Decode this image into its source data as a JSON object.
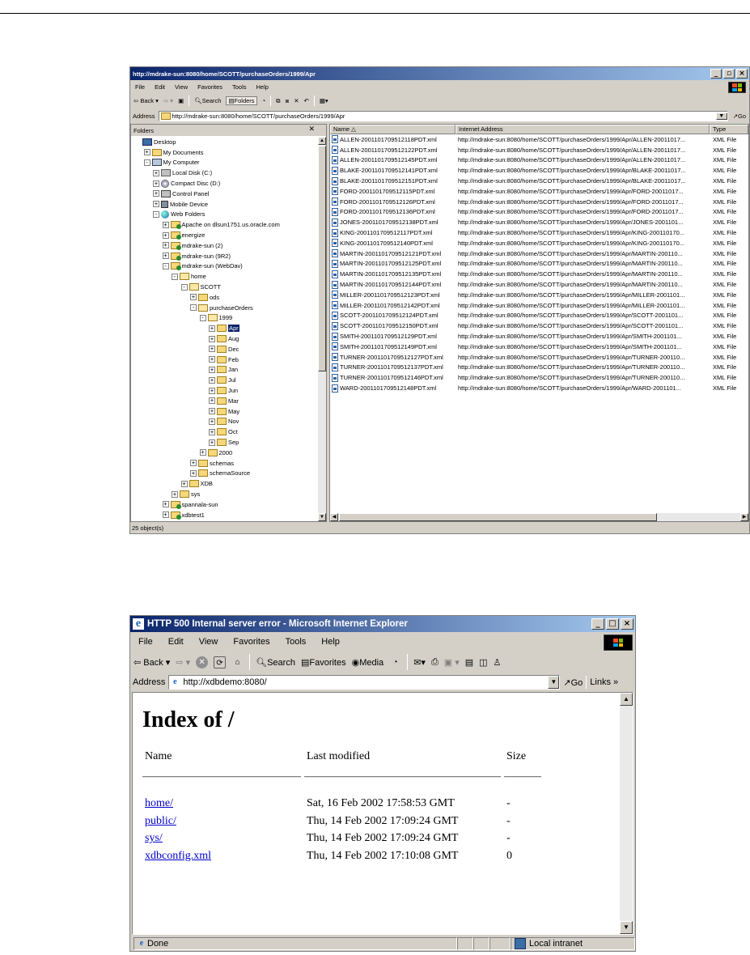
{
  "explorer": {
    "title": "http://mdrake-sun:8080/home/SCOTT/purchaseOrders/1999/Apr",
    "menu": [
      "File",
      "Edit",
      "View",
      "Favorites",
      "Tools",
      "Help"
    ],
    "toolbar": {
      "back": "Back",
      "search": "Search",
      "folders": "Folders"
    },
    "address_label": "Address",
    "address_value": "http://mdrake-sun:8080/home/SCOTT/purchaseOrders/1999/Apr",
    "go_label": "Go",
    "folders_title": "Folders",
    "tree": [
      {
        "label": "Desktop",
        "indent": 0,
        "expander": "",
        "icon": "desk"
      },
      {
        "label": "My Documents",
        "indent": 1,
        "expander": "+",
        "icon": "folder"
      },
      {
        "label": "My Computer",
        "indent": 1,
        "expander": "-",
        "icon": "pc"
      },
      {
        "label": "Local Disk (C:)",
        "indent": 2,
        "expander": "+",
        "icon": "drive"
      },
      {
        "label": "Compact Disc (D:)",
        "indent": 2,
        "expander": "+",
        "icon": "cd"
      },
      {
        "label": "Control Panel",
        "indent": 2,
        "expander": "+",
        "icon": "panel"
      },
      {
        "label": "Mobile Device",
        "indent": 2,
        "expander": "+",
        "icon": "device"
      },
      {
        "label": "Web Folders",
        "indent": 2,
        "expander": "-",
        "icon": "globe"
      },
      {
        "label": "Apache on dlsun1751.us.oracle.com",
        "indent": 3,
        "expander": "+",
        "icon": "webfolder"
      },
      {
        "label": "energize",
        "indent": 3,
        "expander": "+",
        "icon": "webfolder"
      },
      {
        "label": "mdrake-sun (2)",
        "indent": 3,
        "expander": "+",
        "icon": "webfolder"
      },
      {
        "label": "mdrake-sun (9R2)",
        "indent": 3,
        "expander": "+",
        "icon": "webfolder"
      },
      {
        "label": "mdrake-sun (WebDav)",
        "indent": 3,
        "expander": "-",
        "icon": "webfolder"
      },
      {
        "label": "home",
        "indent": 4,
        "expander": "-",
        "icon": "folder"
      },
      {
        "label": "SCOTT",
        "indent": 5,
        "expander": "-",
        "icon": "folder"
      },
      {
        "label": "ods",
        "indent": 6,
        "expander": "+",
        "icon": "folder"
      },
      {
        "label": "purchaseOrders",
        "indent": 6,
        "expander": "-",
        "icon": "folder"
      },
      {
        "label": "1999",
        "indent": 7,
        "expander": "-",
        "icon": "folder"
      },
      {
        "label": "Apr",
        "indent": 8,
        "expander": "+",
        "icon": "folder",
        "selected": true
      },
      {
        "label": "Aug",
        "indent": 8,
        "expander": "+",
        "icon": "folder"
      },
      {
        "label": "Dec",
        "indent": 8,
        "expander": "+",
        "icon": "folder"
      },
      {
        "label": "Feb",
        "indent": 8,
        "expander": "+",
        "icon": "folder"
      },
      {
        "label": "Jan",
        "indent": 8,
        "expander": "+",
        "icon": "folder"
      },
      {
        "label": "Jul",
        "indent": 8,
        "expander": "+",
        "icon": "folder"
      },
      {
        "label": "Jun",
        "indent": 8,
        "expander": "+",
        "icon": "folder"
      },
      {
        "label": "Mar",
        "indent": 8,
        "expander": "+",
        "icon": "folder"
      },
      {
        "label": "May",
        "indent": 8,
        "expander": "+",
        "icon": "folder"
      },
      {
        "label": "Nov",
        "indent": 8,
        "expander": "+",
        "icon": "folder"
      },
      {
        "label": "Oct",
        "indent": 8,
        "expander": "+",
        "icon": "folder"
      },
      {
        "label": "Sep",
        "indent": 8,
        "expander": "+",
        "icon": "folder"
      },
      {
        "label": "2000",
        "indent": 7,
        "expander": "+",
        "icon": "folder"
      },
      {
        "label": "schemas",
        "indent": 6,
        "expander": "+",
        "icon": "folder"
      },
      {
        "label": "schemaSource",
        "indent": 6,
        "expander": "+",
        "icon": "folder"
      },
      {
        "label": "XDB",
        "indent": 5,
        "expander": "+",
        "icon": "folder"
      },
      {
        "label": "sys",
        "indent": 4,
        "expander": "+",
        "icon": "folder"
      },
      {
        "label": "spannala-sun",
        "indent": 3,
        "expander": "+",
        "icon": "webfolder"
      },
      {
        "label": "xdbtest1",
        "indent": 3,
        "expander": "+",
        "icon": "webfolder"
      }
    ],
    "columns": [
      "Name",
      "Internet Address",
      "Type"
    ],
    "files": [
      {
        "name": "ALLEN-2001101709512118PDT.xml",
        "address": "http://mdrake-sun:8080/home/SCOTT/purchaseOrders/1999/Apr/ALLEN-20011017...",
        "type": "XML File"
      },
      {
        "name": "ALLEN-2001101709512122PDT.xml",
        "address": "http://mdrake-sun:8080/home/SCOTT/purchaseOrders/1999/Apr/ALLEN-20011017...",
        "type": "XML File"
      },
      {
        "name": "ALLEN-2001101709512145PDT.xml",
        "address": "http://mdrake-sun:8080/home/SCOTT/purchaseOrders/1999/Apr/ALLEN-20011017...",
        "type": "XML File"
      },
      {
        "name": "BLAKE-2001101709512141PDT.xml",
        "address": "http://mdrake-sun:8080/home/SCOTT/purchaseOrders/1999/Apr/BLAKE-20011017...",
        "type": "XML File"
      },
      {
        "name": "BLAKE-2001101709512151PDT.xml",
        "address": "http://mdrake-sun:8080/home/SCOTT/purchaseOrders/1999/Apr/BLAKE-20011017...",
        "type": "XML File"
      },
      {
        "name": "FORD-2001101709512115PDT.xml",
        "address": "http://mdrake-sun:8080/home/SCOTT/purchaseOrders/1999/Apr/FORD-20011017...",
        "type": "XML File"
      },
      {
        "name": "FORD-2001101709512126PDT.xml",
        "address": "http://mdrake-sun:8080/home/SCOTT/purchaseOrders/1999/Apr/FORD-20011017...",
        "type": "XML File"
      },
      {
        "name": "FORD-2001101709512136PDT.xml",
        "address": "http://mdrake-sun:8080/home/SCOTT/purchaseOrders/1999/Apr/FORD-20011017...",
        "type": "XML File"
      },
      {
        "name": "JONES-2001101709512138PDT.xml",
        "address": "http://mdrake-sun:8080/home/SCOTT/purchaseOrders/1999/Apr/JONES-2001101...",
        "type": "XML File"
      },
      {
        "name": "KING-2001101709512117PDT.xml",
        "address": "http://mdrake-sun:8080/home/SCOTT/purchaseOrders/1999/Apr/KING-200110170...",
        "type": "XML File"
      },
      {
        "name": "KING-2001101709512140PDT.xml",
        "address": "http://mdrake-sun:8080/home/SCOTT/purchaseOrders/1999/Apr/KING-200110170...",
        "type": "XML File"
      },
      {
        "name": "MARTIN-2001101709512121PDT.xml",
        "address": "http://mdrake-sun:8080/home/SCOTT/purchaseOrders/1999/Apr/MARTIN-200110...",
        "type": "XML File"
      },
      {
        "name": "MARTIN-2001101709512125PDT.xml",
        "address": "http://mdrake-sun:8080/home/SCOTT/purchaseOrders/1999/Apr/MARTIN-200110...",
        "type": "XML File"
      },
      {
        "name": "MARTIN-2001101709512135PDT.xml",
        "address": "http://mdrake-sun:8080/home/SCOTT/purchaseOrders/1999/Apr/MARTIN-200110...",
        "type": "XML File"
      },
      {
        "name": "MARTIN-2001101709512144PDT.xml",
        "address": "http://mdrake-sun:8080/home/SCOTT/purchaseOrders/1999/Apr/MARTIN-200110...",
        "type": "XML File"
      },
      {
        "name": "MILLER-2001101709512123PDT.xml",
        "address": "http://mdrake-sun:8080/home/SCOTT/purchaseOrders/1999/Apr/MILLER-2001101...",
        "type": "XML File"
      },
      {
        "name": "MILLER-2001101709512142PDT.xml",
        "address": "http://mdrake-sun:8080/home/SCOTT/purchaseOrders/1999/Apr/MILLER-2001101...",
        "type": "XML File"
      },
      {
        "name": "SCOTT-2001101709512124PDT.xml",
        "address": "http://mdrake-sun:8080/home/SCOTT/purchaseOrders/1999/Apr/SCOTT-2001101...",
        "type": "XML File"
      },
      {
        "name": "SCOTT-2001101709512150PDT.xml",
        "address": "http://mdrake-sun:8080/home/SCOTT/purchaseOrders/1999/Apr/SCOTT-2001101...",
        "type": "XML File"
      },
      {
        "name": "SMITH-2001101709512129PDT.xml",
        "address": "http://mdrake-sun:8080/home/SCOTT/purchaseOrders/1999/Apr/SMITH-2001101...",
        "type": "XML File"
      },
      {
        "name": "SMITH-2001101709512149PDT.xml",
        "address": "http://mdrake-sun:8080/home/SCOTT/purchaseOrders/1999/Apr/SMITH-2001101...",
        "type": "XML File"
      },
      {
        "name": "TURNER-2001101709512127PDT.xml",
        "address": "http://mdrake-sun:8080/home/SCOTT/purchaseOrders/1999/Apr/TURNER-200110...",
        "type": "XML File"
      },
      {
        "name": "TURNER-2001101709512137PDT.xml",
        "address": "http://mdrake-sun:8080/home/SCOTT/purchaseOrders/1999/Apr/TURNER-200110...",
        "type": "XML File"
      },
      {
        "name": "TURNER-2001101709512146PDT.xml",
        "address": "http://mdrake-sun:8080/home/SCOTT/purchaseOrders/1999/Apr/TURNER-200110...",
        "type": "XML File"
      },
      {
        "name": "WARD-2001101709512148PDT.xml",
        "address": "http://mdrake-sun:8080/home/SCOTT/purchaseOrders/1999/Apr/WARD-2001101...",
        "type": "XML File"
      }
    ],
    "status": "25 object(s)"
  },
  "ie": {
    "title": "HTTP 500 Internal server error - Microsoft Internet Explorer",
    "menu": [
      "File",
      "Edit",
      "View",
      "Favorites",
      "Tools",
      "Help"
    ],
    "toolbar": {
      "back": "Back",
      "search": "Search",
      "favorites": "Favorites",
      "media": "Media"
    },
    "address_label": "Address",
    "address_value": "http://xdbdemo:8080/",
    "go_label": "Go",
    "links_label": "Links",
    "heading": "Index of /",
    "columns": [
      "Name",
      "Last modified",
      "Size"
    ],
    "rows": [
      {
        "name": "home/",
        "modified": "Sat, 16 Feb 2002 17:58:53 GMT",
        "size": "-"
      },
      {
        "name": "public/",
        "modified": "Thu, 14 Feb 2002 17:09:24 GMT",
        "size": "-"
      },
      {
        "name": "sys/",
        "modified": "Thu, 14 Feb 2002 17:09:24 GMT",
        "size": "-"
      },
      {
        "name": "xdbconfig.xml",
        "modified": "Thu, 14 Feb 2002 17:10:08 GMT",
        "size": "0"
      }
    ],
    "status_left": "Done",
    "status_zone": "Local intranet"
  }
}
